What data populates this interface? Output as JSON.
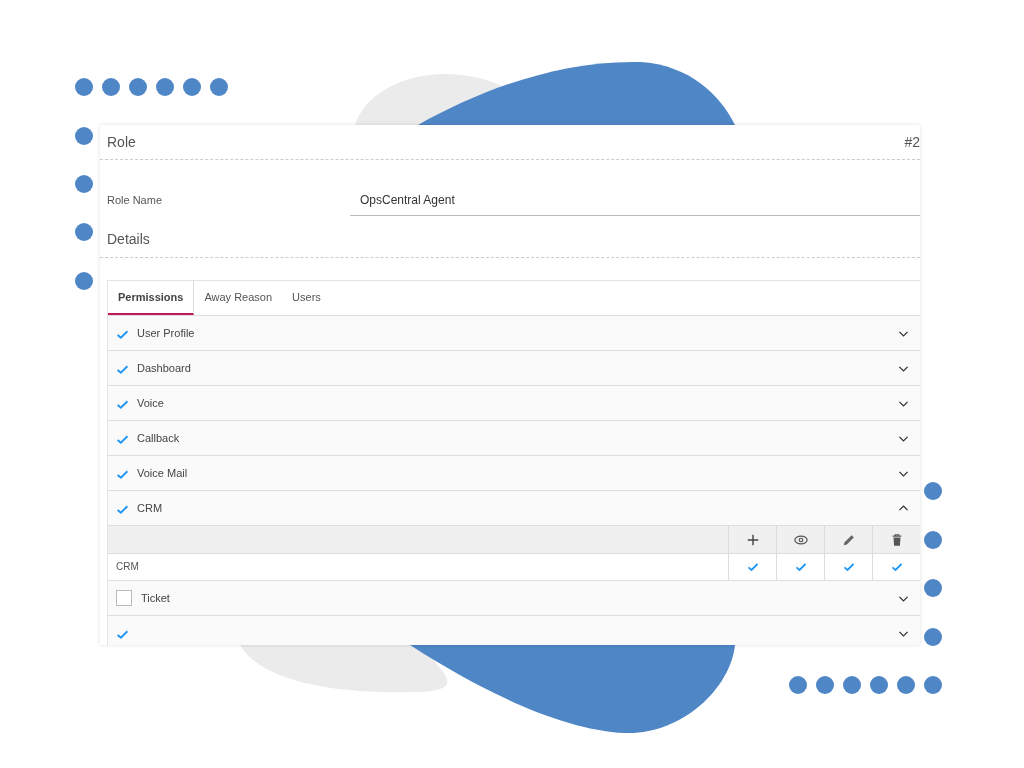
{
  "header": {
    "title": "Role",
    "number": "#2"
  },
  "role_name": {
    "label": "Role Name",
    "value": "OpsCentral Agent"
  },
  "details_title": "Details",
  "tabs": [
    {
      "label": "Permissions",
      "selected": true
    },
    {
      "label": "Away Reason",
      "selected": false
    },
    {
      "label": "Users",
      "selected": false
    }
  ],
  "permissions": [
    {
      "label": "User Profile",
      "checked": true,
      "expanded": false
    },
    {
      "label": "Dashboard",
      "checked": true,
      "expanded": false
    },
    {
      "label": "Voice",
      "checked": true,
      "expanded": false
    },
    {
      "label": "Callback",
      "checked": true,
      "expanded": false
    },
    {
      "label": "Voice Mail",
      "checked": true,
      "expanded": false
    },
    {
      "label": "CRM",
      "checked": true,
      "expanded": true,
      "rows": [
        {
          "name": "CRM",
          "create": true,
          "view": true,
          "edit": true,
          "delete": true
        }
      ]
    },
    {
      "label": "Ticket",
      "checked": false,
      "expanded": false
    },
    {
      "checked": true,
      "expanded": false
    }
  ]
}
